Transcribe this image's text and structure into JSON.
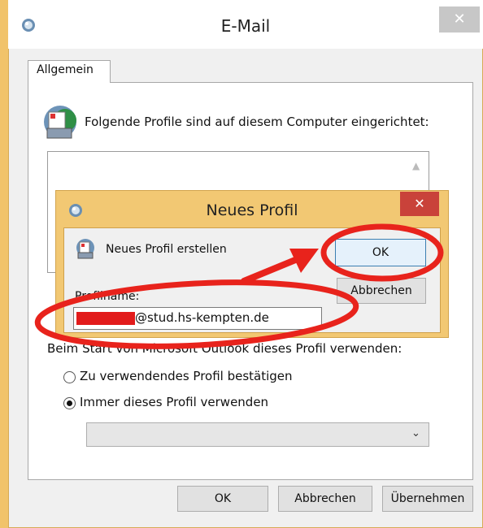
{
  "main_window": {
    "title": "E-Mail",
    "close_glyph": "✕",
    "tab": "Allgemein",
    "profiles_label": "Folgende Profile sind auf diesem Computer eingerichtet:",
    "startup_label": "Beim Start von Microsoft Outlook dieses Profil verwenden:",
    "radio_confirm": "Zu verwendendes Profil bestätigen",
    "radio_always": "Immer dieses Profil verwenden",
    "selected_radio": "always",
    "profile_select_value": "",
    "buttons": {
      "ok": "OK",
      "cancel": "Abbrechen",
      "apply": "Übernehmen"
    }
  },
  "dialog": {
    "title": "Neues Profil",
    "close_glyph": "✕",
    "label": "Neues Profil erstellen",
    "profile_name_label": "Profilname:",
    "profile_name_value": "@stud.hs-kempten.de",
    "buttons": {
      "ok": "OK",
      "cancel": "Abbrechen"
    }
  },
  "colors": {
    "annotation": "#e8231c",
    "dialog_frame": "#f2c873",
    "close_active": "#c9423a"
  }
}
